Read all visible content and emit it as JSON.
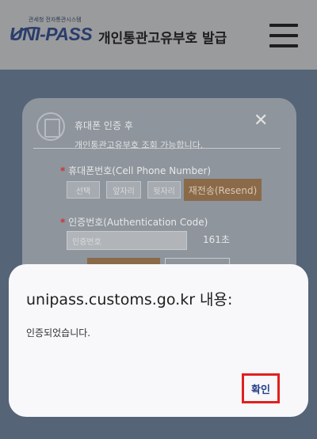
{
  "header": {
    "logo_subtext": "관세청 전자통관시스템",
    "logo_text": "UNI-PASS",
    "title": "개인통관고유부호 발급"
  },
  "background_form": {
    "notice_line1": "휴대폰 인증 후",
    "notice_line2": "개인통관고유부호 조회 가능합니다.",
    "close_symbol": "✕",
    "phone_label": "휴대폰번호(Cell Phone Number)",
    "phone_fields": [
      "선택",
      "앞자리",
      "뒷자리"
    ],
    "resend_label": "재전송(Resend)",
    "code_label": "인증번호(Authentication Code)",
    "code_placeholder": "인증번호",
    "timer": "161초"
  },
  "dialog": {
    "title": "unipass.customs.go.kr 내용:",
    "message": "인증되었습니다.",
    "ok_label": "확인"
  },
  "colors": {
    "brand_navy": "#2a3e6c",
    "highlight_red": "#e02020",
    "ok_text": "#24418a"
  }
}
